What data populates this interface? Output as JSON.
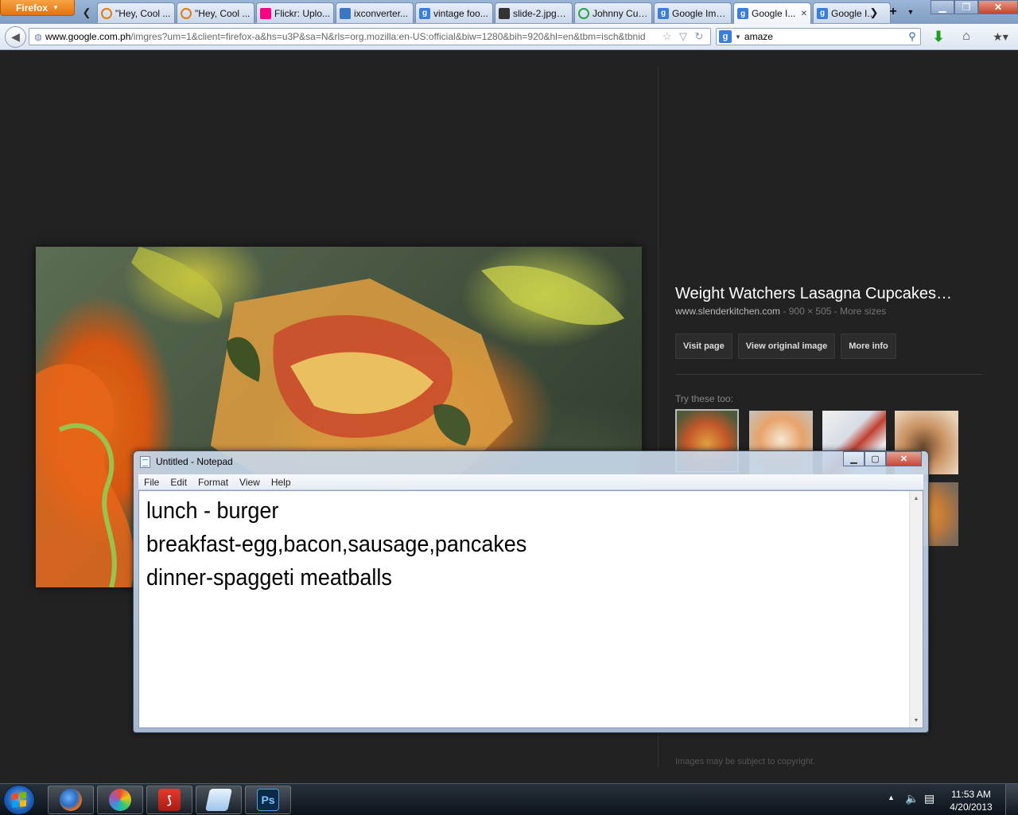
{
  "browser": {
    "app_button": "Firefox",
    "tabs": [
      {
        "label": "\"Hey, Cool ...",
        "icon": "loading-icon",
        "color": "#e07b1a"
      },
      {
        "label": "\"Hey, Cool ...",
        "icon": "loading-icon",
        "color": "#e07b1a"
      },
      {
        "label": "Flickr: Uplo...",
        "icon": "flickr-icon",
        "color": "#ff0084"
      },
      {
        "label": "ixconverter...",
        "icon": "ixconverter-icon",
        "color": "#3a76c4"
      },
      {
        "label": "vintage foo...",
        "icon": "google-icon",
        "color": "#3b7ddd"
      },
      {
        "label": "slide-2.jpg (...",
        "icon": "image-icon",
        "color": "#333333"
      },
      {
        "label": "Johnny Cup...",
        "icon": "loading-icon",
        "color": "#2aa14a"
      },
      {
        "label": "Google Ima...",
        "icon": "google-icon",
        "color": "#3b7ddd"
      },
      {
        "label": "Google I...",
        "icon": "google-icon",
        "color": "#3b7ddd",
        "active": true
      },
      {
        "label": "Google I...",
        "icon": "google-icon",
        "color": "#3b7ddd"
      }
    ],
    "url_host": "www.google.com.ph",
    "url_path": "/imgres?um=1&client=firefox-a&hs=u3P&sa=N&rls=org.mozilla:en-US:official&biw=1280&bih=920&hl=en&tbm=isch&tbnid",
    "search_value": "amaze"
  },
  "result": {
    "title": "Weight Watchers Lasagna Cupcakes…",
    "domain": "www.slenderkitchen.com",
    "dimensions": " - 900 × 505 - ",
    "more_sizes": "More sizes",
    "buttons": [
      "Visit page",
      "View original image",
      "More info"
    ],
    "try_label": "Try these too:",
    "copyright": "Images may be subject to copyright."
  },
  "notepad": {
    "title": "Untitled - Notepad",
    "menu": [
      "File",
      "Edit",
      "Format",
      "View",
      "Help"
    ],
    "lines": [
      "lunch - burger",
      "breakfast-egg,bacon,sausage,pancakes",
      "dinner-spaggeti meatballs"
    ]
  },
  "taskbar": {
    "apps": [
      {
        "name": "firefox-taskbar-icon",
        "label": ""
      },
      {
        "name": "picasa-taskbar-icon",
        "label": ""
      },
      {
        "name": "acrobat-taskbar-icon",
        "label": ""
      },
      {
        "name": "notepad-taskbar-icon",
        "label": ""
      },
      {
        "name": "photoshop-taskbar-icon",
        "label": "Ps"
      }
    ],
    "time": "11:53 AM",
    "date": "4/20/2013"
  }
}
